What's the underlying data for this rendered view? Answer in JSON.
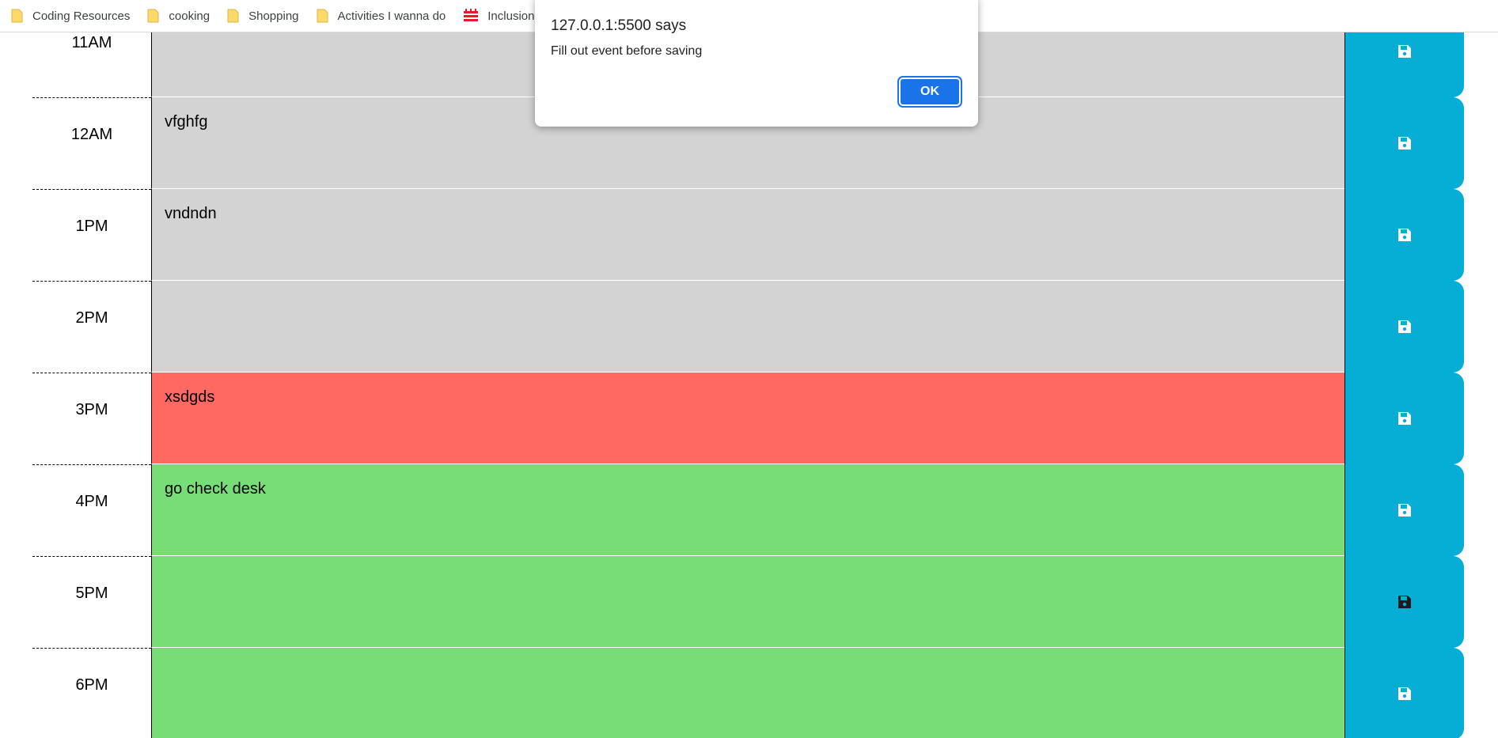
{
  "bookmarks": [
    {
      "label": "Coding Resources",
      "icon": "folder-icon"
    },
    {
      "label": "cooking",
      "icon": "folder-icon"
    },
    {
      "label": "Shopping",
      "icon": "folder-icon"
    },
    {
      "label": "Activities I wanna do",
      "icon": "folder-icon"
    },
    {
      "label": "Inclusion",
      "icon": "red-site-icon"
    }
  ],
  "dialog": {
    "title": "127.0.0.1:5500 says",
    "message": "Fill out event before saving",
    "ok_label": "OK"
  },
  "rows": [
    {
      "hour": "11AM",
      "text": "",
      "state": "past"
    },
    {
      "hour": "12AM",
      "text": "vfghfg",
      "state": "past"
    },
    {
      "hour": "1PM",
      "text": "vndndn",
      "state": "past"
    },
    {
      "hour": "2PM",
      "text": "",
      "state": "past"
    },
    {
      "hour": "3PM",
      "text": "xsdgds",
      "state": "present"
    },
    {
      "hour": "4PM",
      "text": "go check desk",
      "state": "future"
    },
    {
      "hour": "5PM",
      "text": "",
      "state": "future"
    },
    {
      "hour": "6PM",
      "text": "",
      "state": "future"
    }
  ],
  "colors": {
    "past": "#d3d3d3",
    "present": "#ff6961",
    "future": "#77dd77",
    "save": "#06aed5",
    "ok_button": "#1a73e8"
  }
}
